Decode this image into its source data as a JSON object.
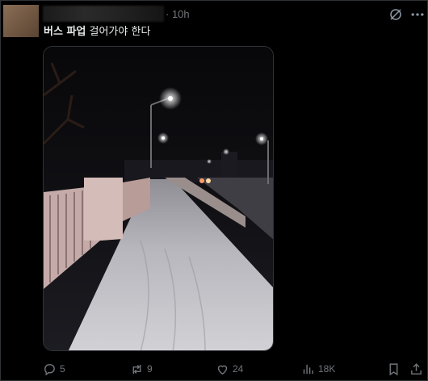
{
  "post": {
    "timestamp": "· 10h",
    "text_bold": "버스 파업",
    "text_rest": " 걸어가야 한다"
  },
  "actions": {
    "reply_count": "5",
    "repost_count": "9",
    "like_count": "24",
    "view_count": "18K"
  },
  "icons": {
    "grok": "grok-icon",
    "more": "more-icon",
    "reply": "reply-icon",
    "repost": "repost-icon",
    "like": "heart-icon",
    "views": "views-icon",
    "bookmark": "bookmark-icon",
    "share": "share-icon"
  },
  "colors": {
    "background": "#000000",
    "text": "#e7e9ea",
    "muted": "#71767b",
    "border": "#2f3336"
  }
}
